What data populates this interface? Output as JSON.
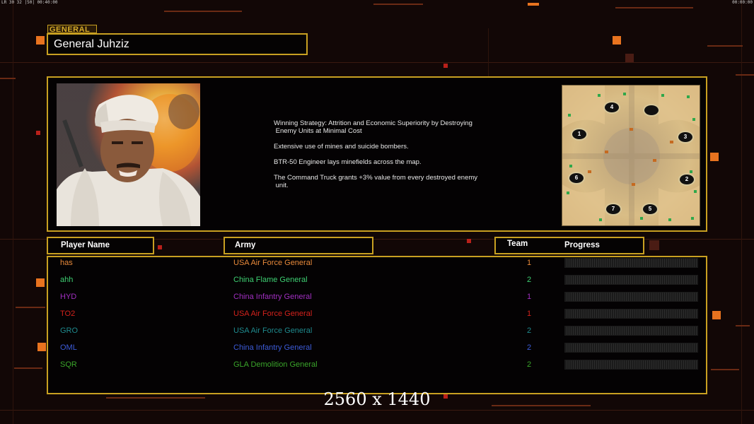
{
  "hud": {
    "left": "LR 30 32 |50| 00:40:00",
    "right": "00:00:00"
  },
  "section_label": "GENERAL",
  "general_name": "General Juhziz",
  "strategy": [
    "Winning Strategy: Attrition and Economic Superiority by Destroying\n Enemy Units at Minimal Cost",
    "Extensive use of mines and suicide bombers.",
    "BTR-50 Engineer lays minefields across the map.",
    "The Command Truck grants +3% value from every destroyed enemy\n unit."
  ],
  "map_slots": [
    "4",
    "",
    "1",
    "3",
    "6",
    "2",
    "7",
    "5"
  ],
  "headers": {
    "player_name": "Player Name",
    "army": "Army",
    "team": "Team",
    "progress": "Progress"
  },
  "players": [
    {
      "name": "has",
      "army": "USA Air Force General",
      "team": "1",
      "color": "#e8893a",
      "progress": 0
    },
    {
      "name": "ahh",
      "army": "China Flame General",
      "team": "2",
      "color": "#3ecf72",
      "progress": 0
    },
    {
      "name": "HYD",
      "army": "China Infantry General",
      "team": "1",
      "color": "#a02fc0",
      "progress": 0
    },
    {
      "name": "TO2",
      "army": "USA Air Force General",
      "team": "1",
      "color": "#d4221c",
      "progress": 0
    },
    {
      "name": "GRO",
      "army": "USA Air Force General",
      "team": "2",
      "color": "#1f8a8e",
      "progress": 0
    },
    {
      "name": "OML",
      "army": "China Infantry General",
      "team": "2",
      "color": "#3c5bd8",
      "progress": 0
    },
    {
      "name": "SQR",
      "army": "GLA Demolition General",
      "team": "2",
      "color": "#3aa52a",
      "progress": 0
    }
  ],
  "resolution_label": "2560 x 1440"
}
